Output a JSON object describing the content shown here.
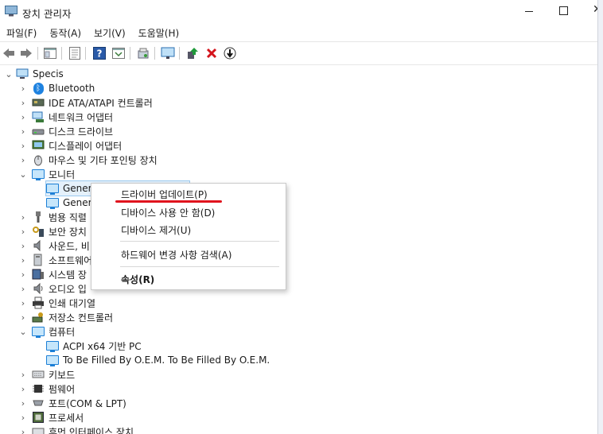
{
  "window": {
    "title": "장치 관리자"
  },
  "menu": [
    "파일(F)",
    "동작(A)",
    "보기(V)",
    "도움말(H)"
  ],
  "tree": {
    "root": "Specis",
    "items": [
      {
        "label": "Bluetooth",
        "icon": "bluetooth-icon"
      },
      {
        "label": "IDE ATA/ATAPI 컨트롤러",
        "icon": "ide-controller-icon"
      },
      {
        "label": "네트워크 어댑터",
        "icon": "network-adapter-icon"
      },
      {
        "label": "디스크 드라이브",
        "icon": "disk-drive-icon"
      },
      {
        "label": "디스플레이 어댑터",
        "icon": "display-adapter-icon"
      },
      {
        "label": "마우스 및 기타 포인팅 장치",
        "icon": "mouse-icon"
      },
      {
        "label": "모니터",
        "icon": "monitor-icon"
      },
      {
        "label": "Gener",
        "icon": "monitor-icon"
      },
      {
        "label": "Gener",
        "icon": "monitor-icon"
      },
      {
        "label": "범용 직렬",
        "icon": "usb-icon"
      },
      {
        "label": "보안 장치",
        "icon": "security-device-icon"
      },
      {
        "label": "사운드, 비",
        "icon": "sound-icon"
      },
      {
        "label": "소프트웨어",
        "icon": "software-device-icon"
      },
      {
        "label": "시스템 장",
        "icon": "system-device-icon"
      },
      {
        "label": "오디오 입",
        "icon": "audio-io-icon"
      },
      {
        "label": "인쇄 대기열",
        "icon": "printer-icon"
      },
      {
        "label": "저장소 컨트롤러",
        "icon": "storage-controller-icon"
      },
      {
        "label": "컴퓨터",
        "icon": "computer-icon"
      },
      {
        "label": "ACPI x64 기반 PC",
        "icon": "computer-icon"
      },
      {
        "label": "To Be Filled By O.E.M. To Be Filled By O.E.M.",
        "icon": "computer-icon"
      },
      {
        "label": "키보드",
        "icon": "keyboard-icon"
      },
      {
        "label": "펌웨어",
        "icon": "firmware-icon"
      },
      {
        "label": "포트(COM & LPT)",
        "icon": "port-icon"
      },
      {
        "label": "프로세서",
        "icon": "processor-icon"
      },
      {
        "label": "휴먼 인터페이스 장치",
        "icon": "hid-icon"
      }
    ]
  },
  "context_menu": {
    "update_driver": "드라이버 업데이트(P)",
    "disable_device": "디바이스 사용 안 함(D)",
    "uninstall_device": "디바이스 제거(U)",
    "scan_hardware": "하드웨어 변경 사항 검색(A)",
    "properties": "속성(R)"
  },
  "colors": {
    "highlight": "#e0141e",
    "selection": "#e5f1fb",
    "monitor_blue": "#1c7fd6"
  }
}
